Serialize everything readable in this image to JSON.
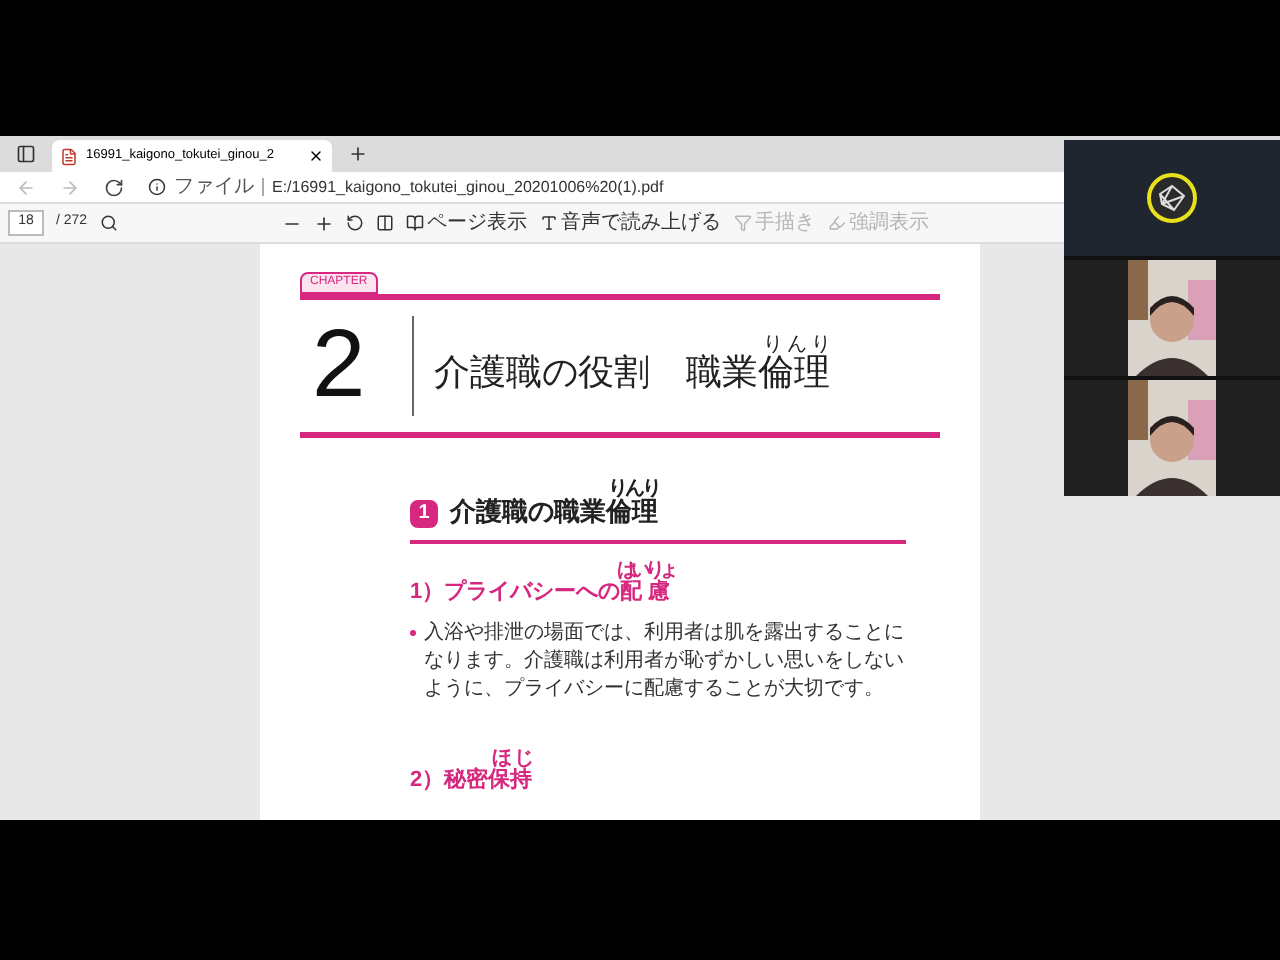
{
  "browser": {
    "tab": {
      "title": "16991_kaigono_tokutei_ginou_2"
    },
    "address": {
      "label": "ファイル",
      "url": "E:/16991_kaigono_tokutei_ginou_20201006%20(1).pdf"
    }
  },
  "pdf_toolbar": {
    "page": "18",
    "total": "/ 272",
    "items": [
      {
        "kind": "view",
        "label": "ページ表示",
        "disabled": false
      },
      {
        "kind": "read",
        "label": "音声で読み上げる",
        "disabled": false
      },
      {
        "kind": "draw",
        "label": "手描き",
        "disabled": true
      },
      {
        "kind": "highlight",
        "label": "強調表示",
        "disabled": true
      }
    ]
  },
  "document": {
    "chapter_tag": "CHAPTER",
    "chapter_number": "2",
    "title_main": "介護職の役割",
    "title_sub": [
      {
        "text": "職業"
      },
      {
        "text": "倫理",
        "ruby": "りんり"
      }
    ],
    "section": {
      "number": "1",
      "heading": [
        {
          "text": "介護職の職業"
        },
        {
          "text": "倫理",
          "ruby": "りんり"
        }
      ],
      "subsections": [
        {
          "heading": [
            {
              "text": "1）プライバシーへの"
            },
            {
              "text": "配慮",
              "ruby": "はいりょ"
            }
          ],
          "body": "入浴や排泄の場面では、利用者は肌を露出することになります。介護職は利用者が恥ずかしい思いをしないように、プライバシーに配慮することが大切です。"
        },
        {
          "heading": [
            {
              "text": "2）秘密"
            },
            {
              "text": "保持",
              "ruby": "ほじ"
            }
          ]
        }
      ]
    }
  },
  "participants": [
    {
      "kind": "logo"
    },
    {
      "kind": "picture"
    },
    {
      "kind": "picture"
    }
  ]
}
